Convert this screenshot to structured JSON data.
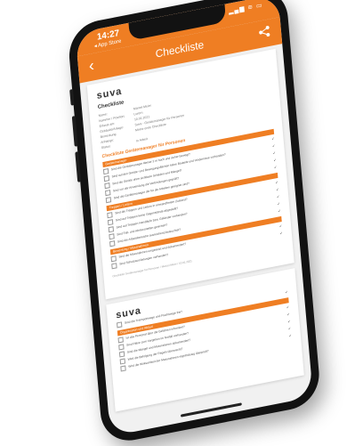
{
  "status": {
    "time": "14:27",
    "back_app": "◂ App Store",
    "icons": "▂▄▆ ≋ ▭"
  },
  "appbar": {
    "back": "‹",
    "title": "Checkliste",
    "share_icon": "share-icon"
  },
  "doc1": {
    "logo": "suva",
    "title": "Checkliste",
    "meta": [
      {
        "k": "Name:",
        "v": "Marcel Meier"
      },
      {
        "k": "Nummer / Position:",
        "v": "Lurern"
      },
      {
        "k": "Erfasst am:",
        "v": "10.01.2021"
      },
      {
        "k": "Gebäude/Anlage:",
        "v": "Suva - Gerätemanager für Personen"
      },
      {
        "k": "Bemerkung:",
        "v": "Meine erste Checkliste"
      },
      {
        "k": "Anhänge:",
        "v": ""
      },
      {
        "k": "Status:",
        "v": "In Arbeit"
      }
    ],
    "section_title": "Checkliste Gerätemanager für Personen",
    "groups": [
      {
        "bar": "Gerätemanager",
        "items": [
          "Sind die Gerätemanager kleiner 2 m hoch und sicher bewegt?",
          "Sind auf den Geräte- und Bewegungsflächen keine Bauteile und Hindernisse vorhanden?",
          "Sind die Geräte ohne sichtbare Schäden und Mängel?",
          "Sind vor der Anwendung die Verbindungen geprüft?",
          "Sind die Gerätemanager die für die Arbeiten geeignet sind?"
        ]
      },
      {
        "bar": "Treppen / Leitern",
        "items": [
          "Sind die Treppen und Leitern in einwandfreiem Zustand?",
          "Sind auf Treppen keine Gegenstände abgestellt?",
          "Sind auf Treppen Handläufe bzw. Geländer vorhanden?",
          "Sind Fall- und Absturzstellen gesichert?",
          "Sind die Arbeitsbereiche ausreichend beleuchtet?"
        ]
      },
      {
        "bar": "Bewertung / Massnahmen",
        "items": [
          "Sind die Massnahmen umgesetzt und dokumentiert?",
          "Sind Schutzausrüstungen vorhanden?"
        ]
      }
    ],
    "footer": "Checkliste Gerätemanager für Personen / Marcel Meier / 10.01.2021"
  },
  "doc2": {
    "logo": "suva",
    "items_top": [
      "Sind die Transportwege und Fluchtwege frei?"
    ],
    "bar": "Organisation und Ablauf",
    "items": [
      "Ist das Personal über die Gefahren informiert?",
      "Sind Pläne zum Vorgehen im Notfall vorhanden?",
      "Sind die Mängel und Massnahmen dokumentiert?",
      "Wird die Befolgung der Regeln überwacht?",
      "Wird die Wirksamkeit der Massnahmen regelmässig überprüft?"
    ]
  }
}
